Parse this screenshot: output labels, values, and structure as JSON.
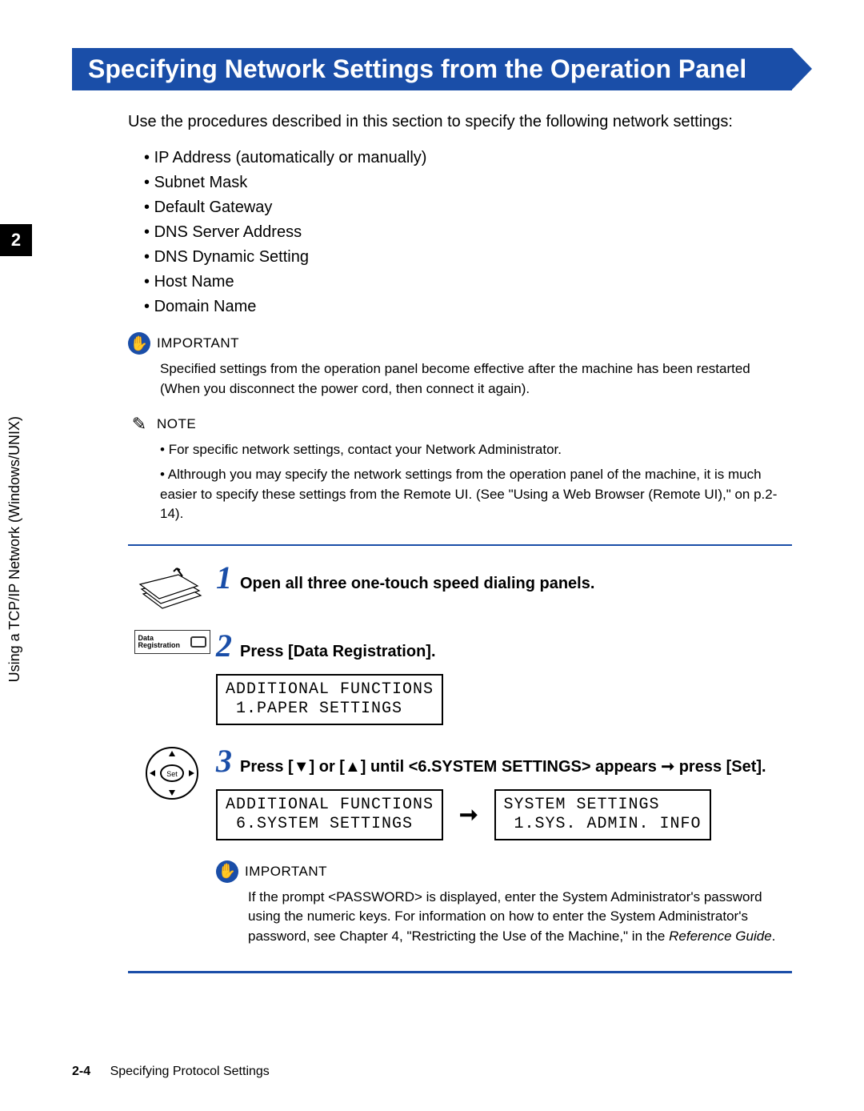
{
  "title": "Specifying Network Settings from the Operation Panel",
  "chapter_tab": "2",
  "side_label": "Using a TCP/IP Network (Windows/UNIX)",
  "intro": "Use the procedures described in this section to specify the following network settings:",
  "network_settings": [
    "IP Address (automatically or manually)",
    "Subnet Mask",
    "Default Gateway",
    "DNS Server Address",
    "DNS Dynamic Setting",
    "Host Name",
    "Domain Name"
  ],
  "important1": {
    "label": "IMPORTANT",
    "text": "Specified settings from the operation panel become effective after the machine has been restarted (When you disconnect the power cord, then connect it again)."
  },
  "note": {
    "label": "NOTE",
    "items": [
      "For specific network settings, contact your Network Administrator.",
      "Althrough you may specify the network settings from the operation panel of the machine, it is much easier to specify these settings from the Remote UI. (See \"Using a Web Browser (Remote UI),\" on p.2-14)."
    ]
  },
  "steps": {
    "s1": {
      "num": "1",
      "title": "Open all three one-touch speed dialing panels."
    },
    "s2": {
      "num": "2",
      "title": "Press [Data Registration].",
      "icon_label": "Data\nRegistration",
      "lcd1": "ADDITIONAL FUNCTIONS\n 1.PAPER SETTINGS"
    },
    "s3": {
      "num": "3",
      "title": "Press [▼] or [▲] until <6.SYSTEM SETTINGS> appears ➞ press [Set].",
      "lcd1": "ADDITIONAL FUNCTIONS\n 6.SYSTEM SETTINGS",
      "arrow": "➞",
      "lcd2": "SYSTEM SETTINGS\n 1.SYS. ADMIN. INFO"
    }
  },
  "important2": {
    "label": "IMPORTANT",
    "text_prefix": "If the prompt <PASSWORD> is displayed, enter the System Administrator's password using the numeric keys. For information on how to enter the System Administrator's password, see Chapter 4, \"Restricting the Use of the Machine,\" in the ",
    "text_italic": "Reference Guide",
    "text_suffix": "."
  },
  "footer": {
    "page": "2-4",
    "section": "Specifying Protocol Settings"
  }
}
